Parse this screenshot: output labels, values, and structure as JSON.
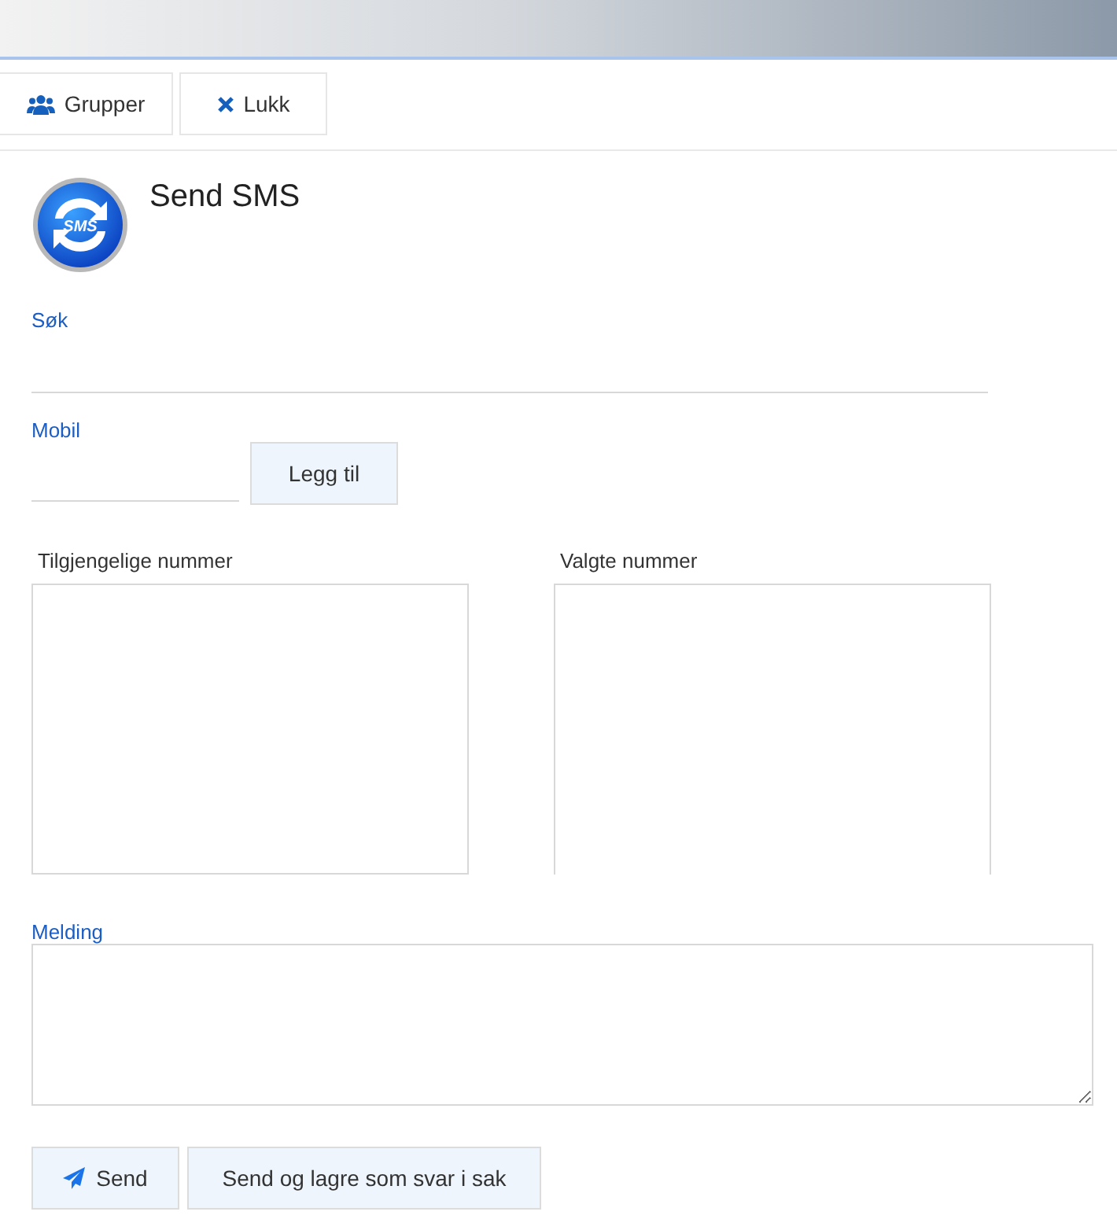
{
  "toolbar": [
    {
      "kind": "groups",
      "label": "Grupper"
    },
    {
      "kind": "close",
      "label": "Lukk"
    }
  ],
  "header": {
    "logo_text": "SMS",
    "title": "Send SMS"
  },
  "search": {
    "label": "Søk"
  },
  "mobile": {
    "label": "Mobil",
    "button": "Legg til"
  },
  "lists": [
    {
      "label": "Tilgjengelige nummer"
    },
    {
      "label": "Valgte nummer"
    }
  ],
  "message": {
    "label": "Melding"
  },
  "actions": [
    {
      "kind": "send",
      "label": "Send"
    },
    {
      "kind": "plain",
      "label": "Send og lagre som svar i sak"
    }
  ]
}
